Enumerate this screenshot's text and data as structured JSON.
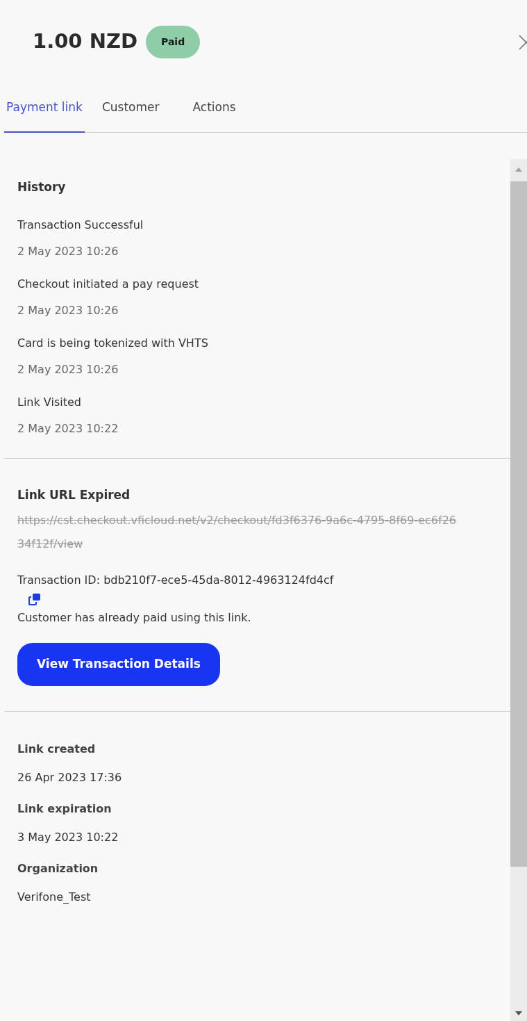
{
  "header": {
    "amount": "1.00 NZD",
    "status": {
      "label": "Paid",
      "color": "#8fcca8"
    }
  },
  "tabs": [
    {
      "label": "Payment link",
      "selected": true
    },
    {
      "label": "Customer",
      "selected": false
    },
    {
      "label": "Actions",
      "selected": false
    }
  ],
  "history": {
    "heading": "History",
    "events": [
      {
        "title": "Transaction Successful",
        "time": "2 May 2023 10:26"
      },
      {
        "title": "Checkout initiated a pay request",
        "time": "2 May 2023 10:26"
      },
      {
        "title": "Card is being tokenized with VHTS",
        "time": "2 May 2023 10:26"
      },
      {
        "title": "Link Visited",
        "time": "2 May 2023 10:22"
      }
    ]
  },
  "link": {
    "heading": "Link URL Expired",
    "url": "https://cst.checkout.vficloud.net/v2/checkout/fd3f6376-9a6c-4795-8f69-ec6f2634f12f/view",
    "expired": true,
    "transaction_id": "Transaction ID: bdb210f7-ece5-45da-8012-4963124fd4cf",
    "message": "Customer has already paid using this link.",
    "button": "View Transaction Details"
  },
  "details": [
    {
      "label": "Link created",
      "value": "26 Apr 2023 17:36"
    },
    {
      "label": "Link expiration",
      "value": "3 May 2023 10:22"
    },
    {
      "label": "Organization",
      "value": "Verifone_Test"
    }
  ]
}
